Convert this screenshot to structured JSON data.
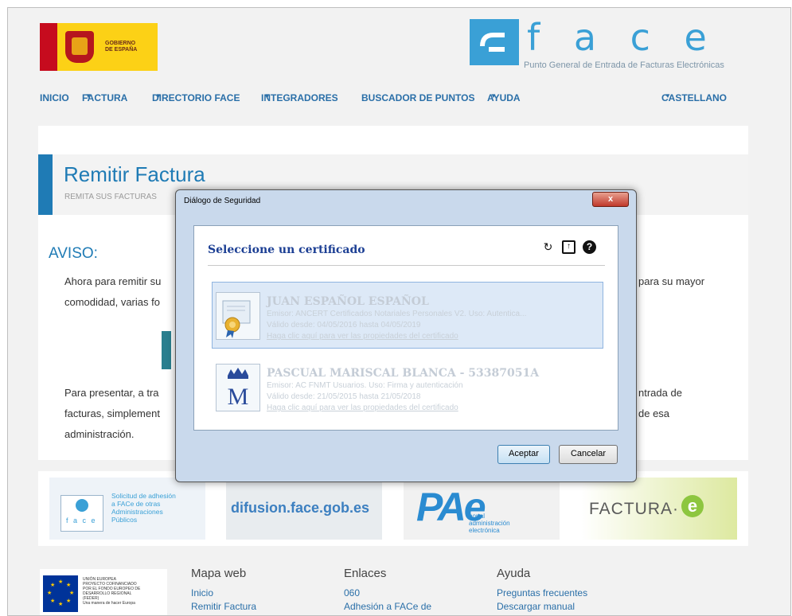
{
  "header": {
    "gov_logo_text": [
      "GOBIERNO",
      "DE ESPAÑA"
    ],
    "face_letters": "f a c e",
    "face_subtitle": "Punto General de Entrada de Facturas Electrónicas"
  },
  "nav": {
    "items": [
      "INICIO",
      "FACTURA",
      "DIRECTORIO FACE",
      "INTEGRADORES",
      "BUSCADOR DE PUNTOS",
      "AYUDA"
    ],
    "language": "CASTELLANO",
    "caret": "▼"
  },
  "page": {
    "title": "Remitir Factura",
    "subtitle": "REMITA SUS FACTURAS",
    "aviso": "AVISO:",
    "p1_left": "Ahora para remitir su",
    "p1_right": "para su mayor",
    "p2_left": "comodidad, varias fo",
    "p3_left": "Para presentar, a tra",
    "p3_right": "ntrada de",
    "p4_left": "facturas, simplement",
    "p4_right": "de esa",
    "p5_left": "administración."
  },
  "banners": {
    "adhesion": [
      "Solicitud de adhesión",
      "a FACe de otras",
      "Administraciones",
      "Públicos"
    ],
    "adhesion_logo": "f a c e",
    "difusion": "difusion.face.gob.es",
    "pae": "PAe",
    "pae_sub": [
      "portal",
      "administración",
      "electrónica"
    ],
    "factura_e": "FACTURA·",
    "factura_e_letter": "e"
  },
  "footer": {
    "eu_text": [
      "UNIÓN EUROPEA",
      "PROYECTO COFINANCIADO",
      "POR EL FONDO EUROPEO DE",
      "DESARROLLO REGIONAL",
      "(FEDER)",
      "Una manera de hacer Europa"
    ],
    "col1": {
      "heading": "Mapa web",
      "links": [
        "Inicio",
        "Remitir Factura"
      ]
    },
    "col2": {
      "heading": "Enlaces",
      "links": [
        "060",
        "Adhesión a FACe de"
      ]
    },
    "col3": {
      "heading": "Ayuda",
      "links": [
        "Preguntas frecuentes",
        "Descargar manual"
      ]
    }
  },
  "dialog": {
    "title": "Diálogo de Seguridad",
    "close": "x",
    "heading": "Seleccione un certificado",
    "icons": [
      "refresh-icon",
      "import-icon",
      "help-icon"
    ],
    "certificates": [
      {
        "name": "JUAN ESPAÑOL ESPAÑOL",
        "issuer": "Emisor: ANCERT Certificados Notariales Personales V2. Uso: Autentica...",
        "validity": "Válido desde: 04/05/2016 hasta 04/05/2019",
        "link": "Haga clic aquí para ver las propiedades del certificado",
        "selected": true
      },
      {
        "name": "PASCUAL MARISCAL BLANCA - 53387051A",
        "issuer": "Emisor: AC FNMT Usuarios. Uso: Firma y autenticación",
        "validity": "Válido desde: 21/05/2015 hasta 21/05/2018",
        "link": "Haga clic aquí para ver las propiedades del certificado",
        "selected": false
      }
    ],
    "accept": "Aceptar",
    "cancel": "Cancelar"
  },
  "colors": {
    "accent": "#1f7bb5",
    "nav": "#2a6fa8",
    "dialog_heading": "#1c3f94"
  }
}
